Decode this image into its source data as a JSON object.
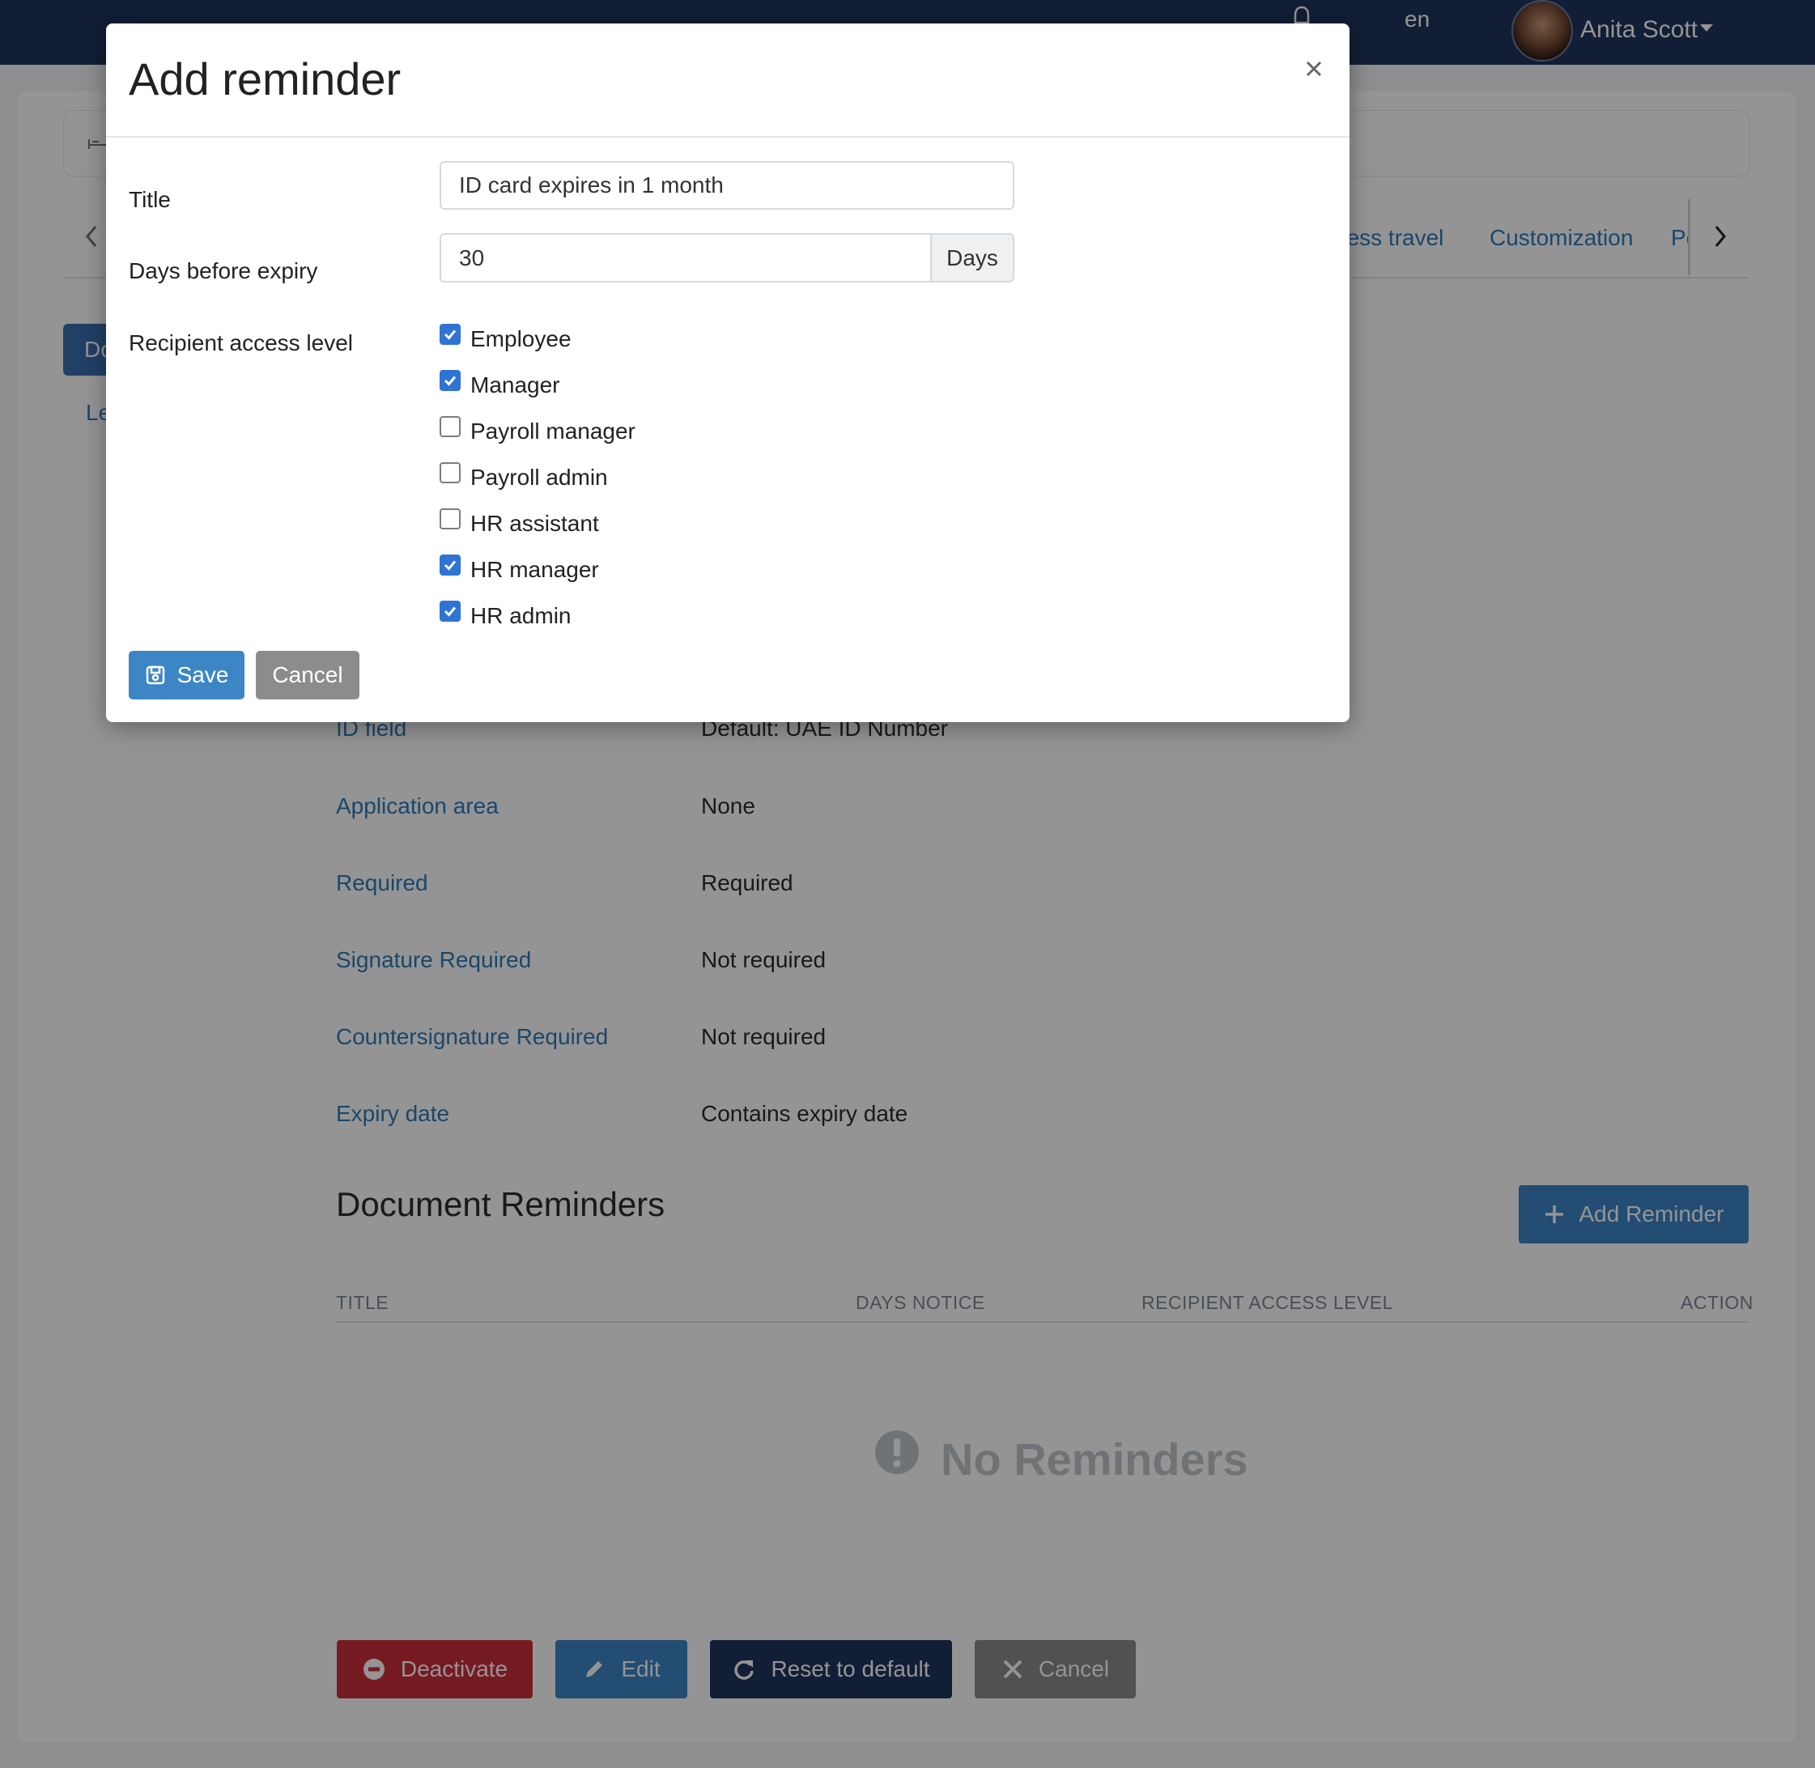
{
  "header": {
    "language": "en",
    "user_name": "Anita Scott"
  },
  "background": {
    "tabs": [
      "ness travel",
      "Customization",
      "Po"
    ],
    "side_active": "Do",
    "side_link": "Le",
    "properties": [
      {
        "label": "ID field",
        "value": "Default: UAE ID Number"
      },
      {
        "label": "Application area",
        "value": "None"
      },
      {
        "label": "Required",
        "value": "Required"
      },
      {
        "label": "Signature Required",
        "value": "Not required"
      },
      {
        "label": "Countersignature Required",
        "value": "Not required"
      },
      {
        "label": "Expiry date",
        "value": "Contains expiry date"
      }
    ],
    "reminders": {
      "title": "Document Reminders",
      "add_label": "Add Reminder",
      "columns": [
        "TITLE",
        "DAYS NOTICE",
        "RECIPIENT ACCESS LEVEL",
        "ACTION"
      ],
      "empty_text": "No Reminders"
    },
    "actions": {
      "deactivate": "Deactivate",
      "edit": "Edit",
      "reset": "Reset to default",
      "cancel": "Cancel"
    }
  },
  "modal": {
    "title": "Add reminder",
    "fields": {
      "title_label": "Title",
      "title_value": "ID card expires in 1 month",
      "days_label": "Days before expiry",
      "days_value": "30",
      "days_unit": "Days",
      "access_label": "Recipient access level"
    },
    "access_levels": [
      {
        "label": "Employee",
        "checked": true
      },
      {
        "label": "Manager",
        "checked": true
      },
      {
        "label": "Payroll manager",
        "checked": false
      },
      {
        "label": "Payroll admin",
        "checked": false
      },
      {
        "label": "HR assistant",
        "checked": false
      },
      {
        "label": "HR manager",
        "checked": true
      },
      {
        "label": "HR admin",
        "checked": true
      }
    ],
    "save_label": "Save",
    "cancel_label": "Cancel"
  },
  "colors": {
    "topbar": "#1f355e",
    "primary": "#3d86c6",
    "danger": "#cc2e3b",
    "checkbox": "#2f73d3"
  }
}
